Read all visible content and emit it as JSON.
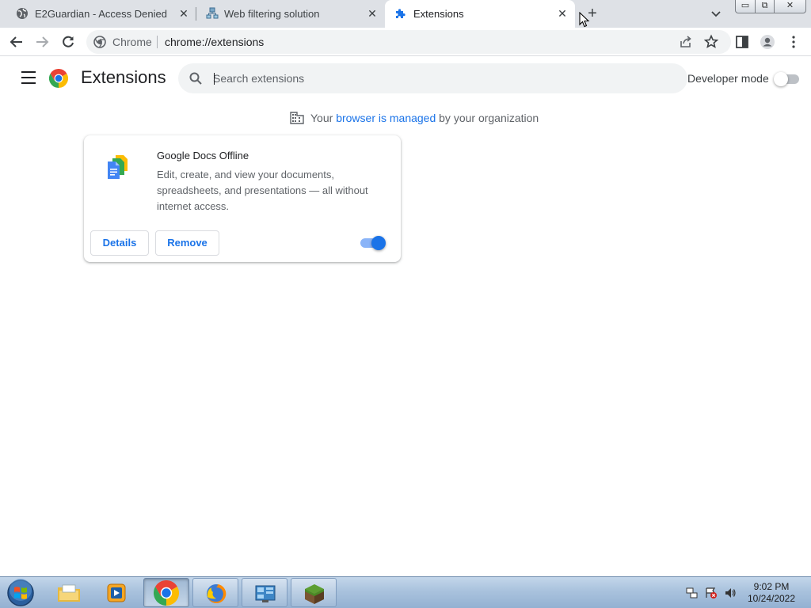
{
  "tabs": [
    {
      "title": "E2Guardian - Access Denied",
      "favicon": "globe-icon",
      "active": false
    },
    {
      "title": "Web filtering solution",
      "favicon": "network-icon",
      "active": false
    },
    {
      "title": "Extensions",
      "favicon": "puzzle-icon",
      "active": true
    }
  ],
  "window_controls": {
    "minimize": "minimize-icon",
    "restore": "restore-icon",
    "close": "close-icon"
  },
  "toolbar": {
    "site_label": "Chrome",
    "url": "chrome://extensions"
  },
  "extensions_page": {
    "title": "Extensions",
    "search_placeholder": "Search extensions",
    "developer_mode_label": "Developer mode",
    "developer_mode_on": false,
    "managed_prefix": "Your ",
    "managed_link": "browser is managed",
    "managed_suffix": " by your organization"
  },
  "extension_card": {
    "name": "Google Docs Offline",
    "description": "Edit, create, and view your documents, spreadsheets, and presentations — all without internet access.",
    "details_label": "Details",
    "remove_label": "Remove",
    "enabled": true
  },
  "taskbar": {
    "apps": [
      "file-explorer-icon",
      "media-player-icon",
      "chrome-icon",
      "firefox-icon",
      "control-panel-icon",
      "minecraft-icon"
    ],
    "clock_time": "9:02 PM",
    "clock_date": "10/24/2022"
  },
  "colors": {
    "accent": "#1a73e8",
    "tabstrip": "#dee1e6",
    "omnibox": "#f1f3f4"
  }
}
